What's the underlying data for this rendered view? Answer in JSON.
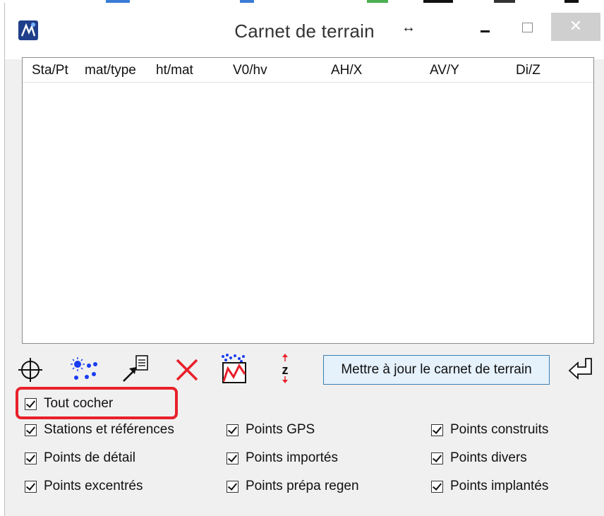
{
  "window": {
    "title": "Carnet de terrain",
    "close_glyph": "✕",
    "resize_glyph": "↔"
  },
  "list": {
    "columns": [
      "Sta/Pt",
      "mat/type",
      "ht/mat",
      "V0/hv",
      "AH/X",
      "AV/Y",
      "Di/Z"
    ],
    "rows": []
  },
  "toolbar": {
    "icons": [
      "crosshair-icon",
      "point-cloud-icon",
      "export-arrow-icon",
      "delete-x-icon",
      "profile-chart-icon",
      "z-elevation-icon",
      "return-icon"
    ],
    "z_glyph": "z",
    "update_label": "Mettre à jour le carnet de terrain"
  },
  "filters": {
    "select_all": {
      "label": "Tout cocher",
      "checked": true
    },
    "items": [
      {
        "label": "Stations et références",
        "checked": true
      },
      {
        "label": "Points GPS",
        "checked": true
      },
      {
        "label": "Points construits",
        "checked": true
      },
      {
        "label": "Points de détail",
        "checked": true
      },
      {
        "label": "Points importés",
        "checked": true
      },
      {
        "label": "Points divers",
        "checked": true
      },
      {
        "label": "Points excentrés",
        "checked": true
      },
      {
        "label": "Points prépa regen",
        "checked": true
      },
      {
        "label": "Points implantés",
        "checked": true
      }
    ]
  },
  "colors": {
    "highlight": "#e8202a",
    "delete_icon": "#e8202a",
    "button_border": "#3c7fb1",
    "points_blue": "#1a3cf0"
  }
}
